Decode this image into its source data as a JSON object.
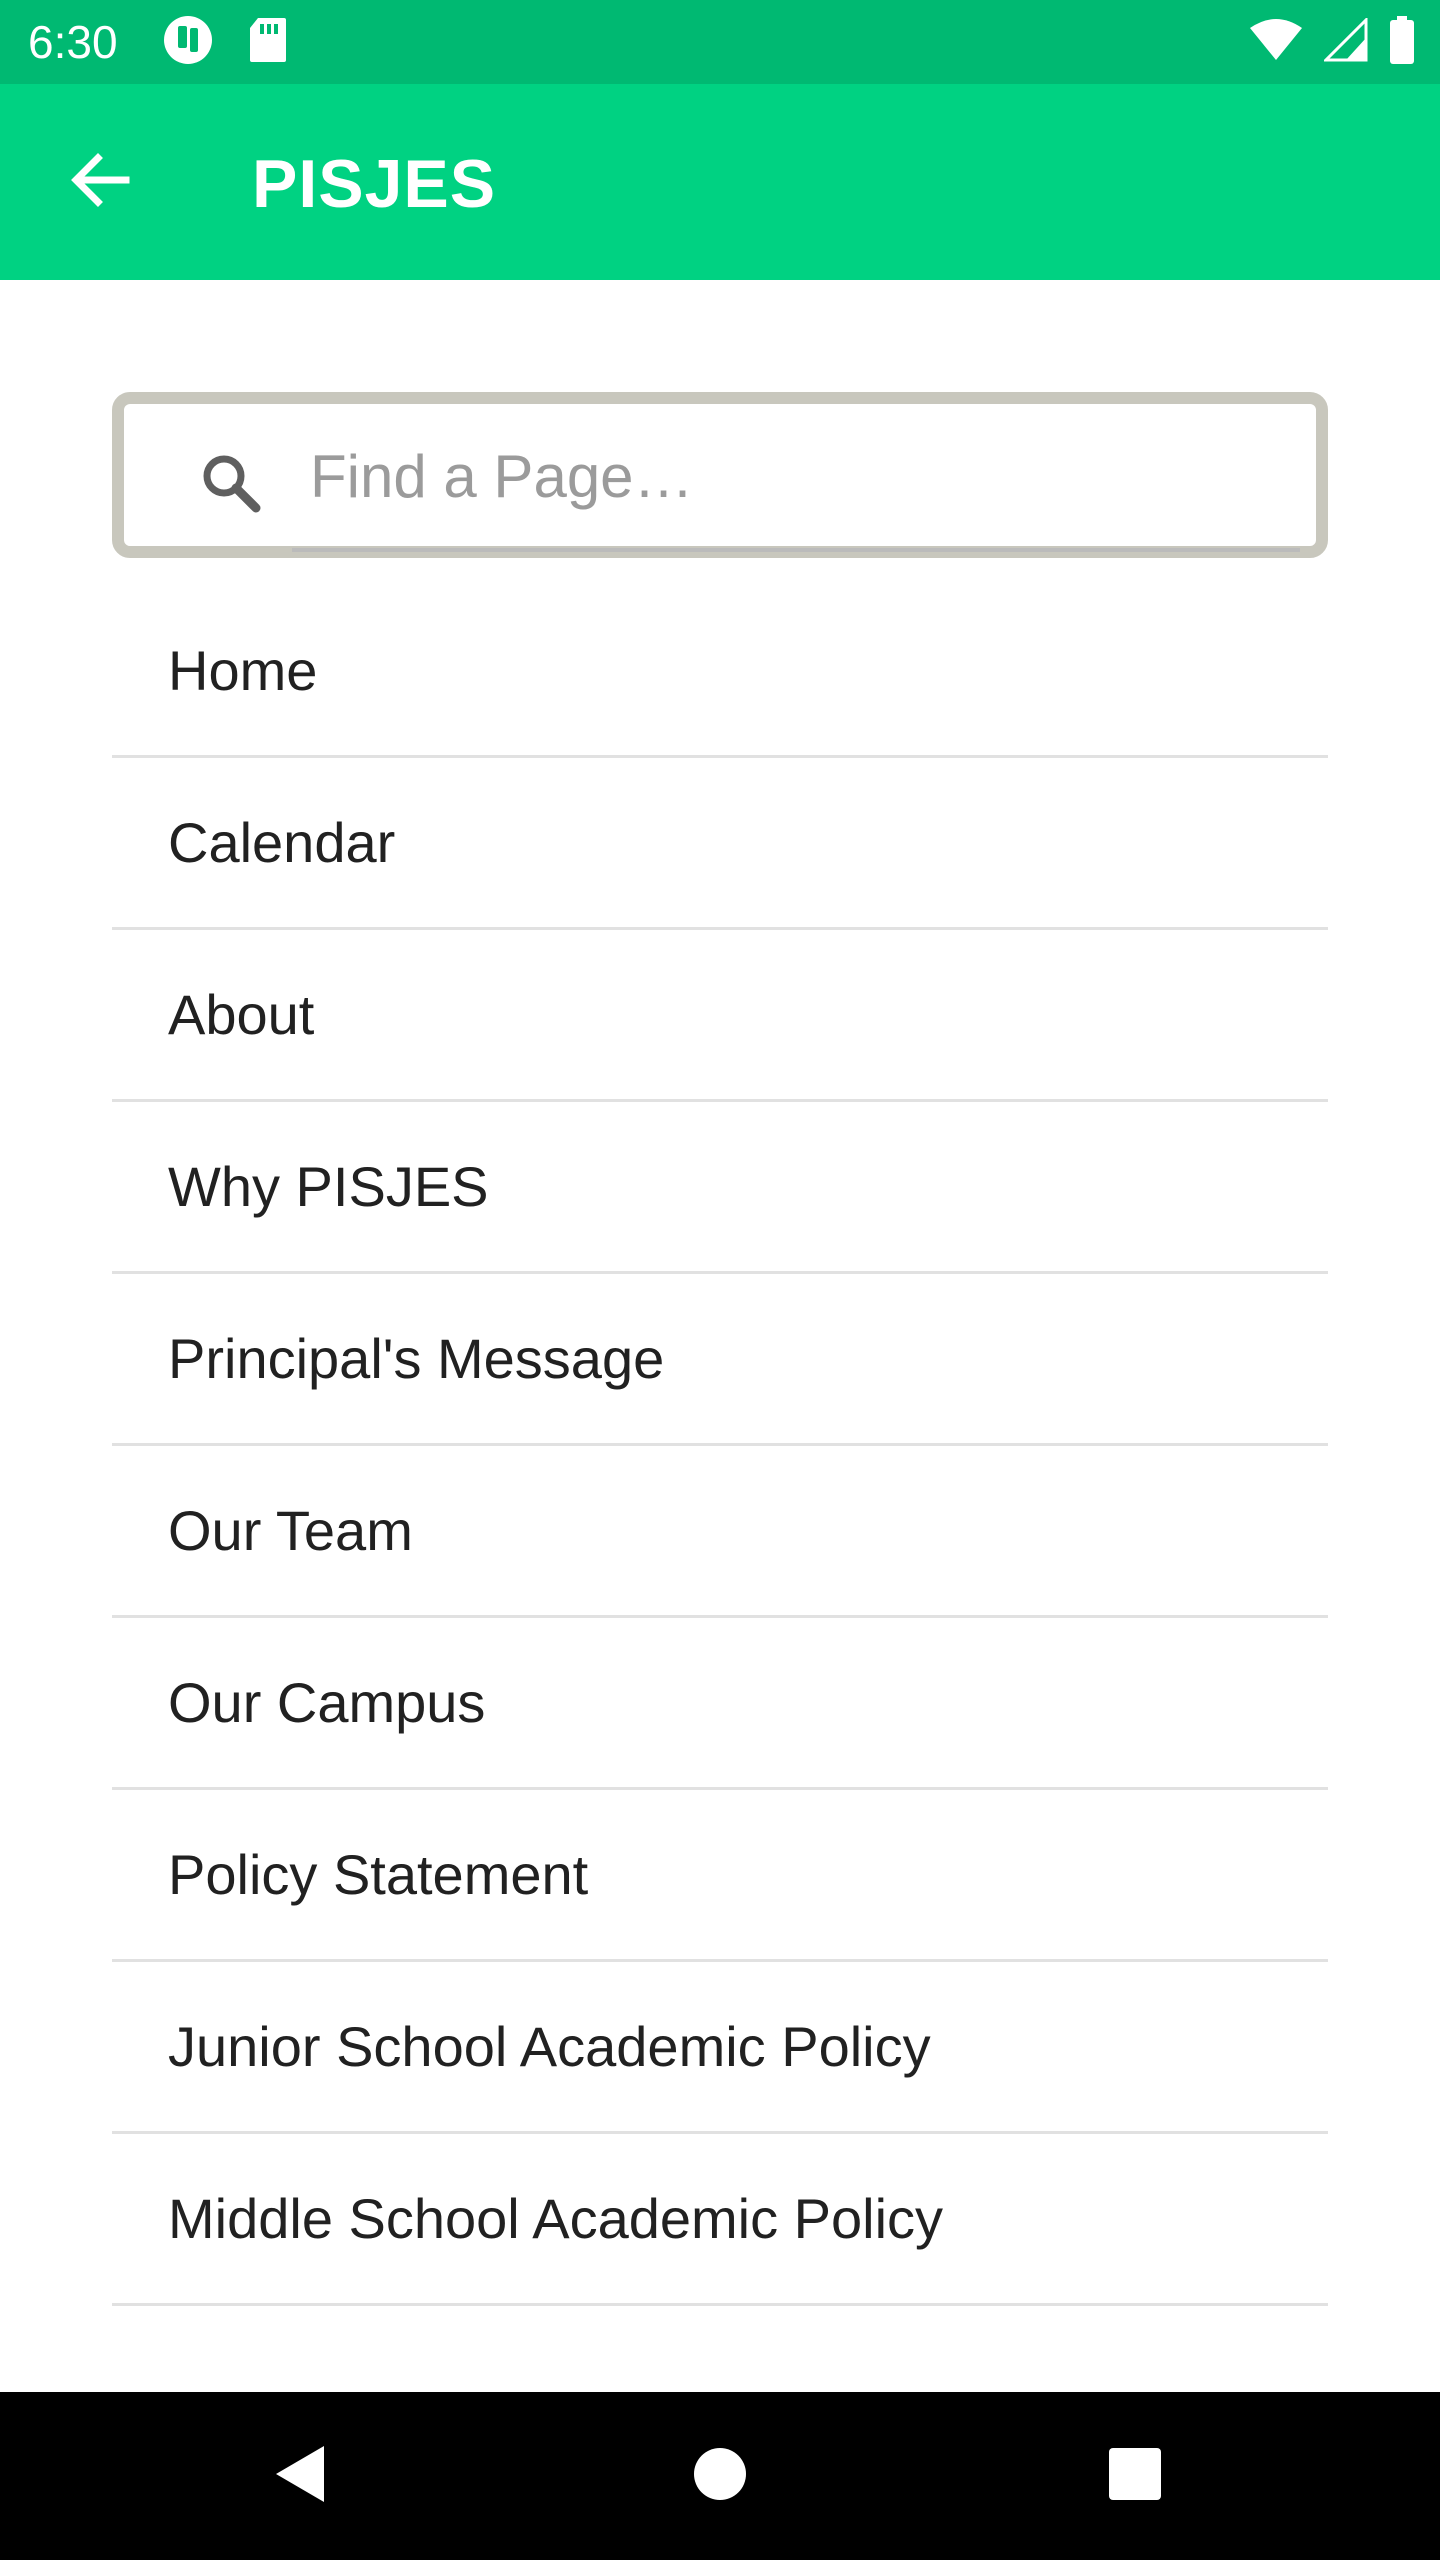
{
  "status_bar": {
    "time": "6:30",
    "icons": [
      "notification-app-icon",
      "sd-card-icon",
      "wifi-icon",
      "signal-icon",
      "battery-icon"
    ]
  },
  "app_bar": {
    "title": "PISJES",
    "back_icon": "arrow-back-icon"
  },
  "search": {
    "placeholder": "Find a Page…",
    "value": ""
  },
  "pages": [
    {
      "label": "Home"
    },
    {
      "label": "Calendar"
    },
    {
      "label": "About"
    },
    {
      "label": "Why PISJES"
    },
    {
      "label": "Principal's Message"
    },
    {
      "label": "Our Team"
    },
    {
      "label": "Our Campus"
    },
    {
      "label": "Policy Statement"
    },
    {
      "label": "Junior School Academic Policy"
    },
    {
      "label": "Middle School Academic Policy"
    }
  ],
  "nav_bar": {
    "buttons": [
      "back-triangle-icon",
      "home-circle-icon",
      "recents-square-icon"
    ]
  },
  "colors": {
    "status_bar": "#00b972",
    "app_bar": "#00d282",
    "search_border": "#c8c7bd"
  }
}
